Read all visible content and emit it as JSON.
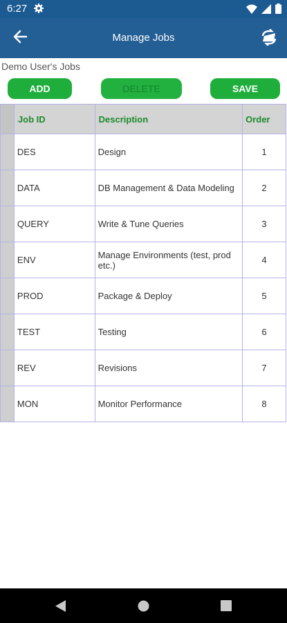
{
  "status": {
    "time": "6:27"
  },
  "app_bar": {
    "title": "Manage Jobs"
  },
  "page": {
    "label": "Demo User's Jobs"
  },
  "buttons": {
    "add": "ADD",
    "delete": "DELETE",
    "save": "SAVE"
  },
  "table": {
    "headers": {
      "job_id": "Job ID",
      "description": "Description",
      "order": "Order"
    },
    "rows": [
      {
        "job_id": "DES",
        "description": "Design",
        "order": "1"
      },
      {
        "job_id": "DATA",
        "description": "DB Management & Data Modeling",
        "order": "2"
      },
      {
        "job_id": "QUERY",
        "description": "Write & Tune Queries",
        "order": "3"
      },
      {
        "job_id": "ENV",
        "description": "Manage Environments (test, prod etc.)",
        "order": "4"
      },
      {
        "job_id": "PROD",
        "description": "Package & Deploy",
        "order": "5"
      },
      {
        "job_id": "TEST",
        "description": "Testing",
        "order": "6"
      },
      {
        "job_id": "REV",
        "description": "Revisions",
        "order": "7"
      },
      {
        "job_id": "MON",
        "description": "Monitor Performance",
        "order": "8"
      }
    ]
  }
}
